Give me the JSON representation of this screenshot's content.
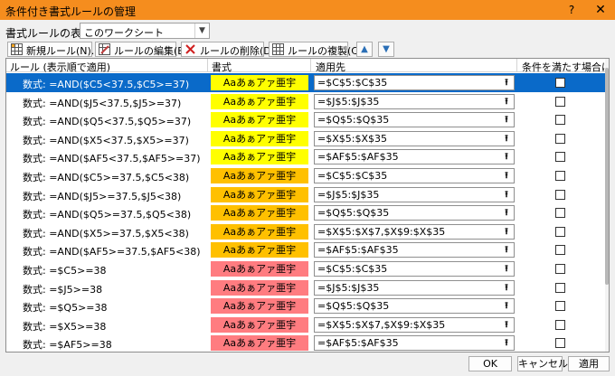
{
  "window": {
    "title": "条件付き書式ルールの管理",
    "help": "?",
    "close": "✕"
  },
  "scope": {
    "label": "書式ルールの表示(S):",
    "value": "このワークシート"
  },
  "toolbar": {
    "new_rule": "新規ルール(N)...",
    "edit_rule": "ルールの編集(E)...",
    "delete_rule": "ルールの削除(D)",
    "duplicate_rule": "ルールの複製(C)"
  },
  "columns": {
    "rule": "ルール (表示順で適用)",
    "format": "書式",
    "applies_to": "適用先",
    "stop_if_true": "条件を満たす場合は停止"
  },
  "colors": {
    "yellow": "#ffff00",
    "orange": "#ffc000",
    "red": "#ff7c80",
    "selection": "#0a6ac9"
  },
  "preview_text": "Aaあぁアァ亜宇",
  "rules": [
    {
      "rule": "数式: =AND($C5<37.5,$C5>=37)",
      "fill": "yellow",
      "range": "=$C$5:$C$35",
      "stop": false,
      "selected": true
    },
    {
      "rule": "数式: =AND($J5<37.5,$J5>=37)",
      "fill": "yellow",
      "range": "=$J$5:$J$35",
      "stop": false,
      "selected": false
    },
    {
      "rule": "数式: =AND($Q5<37.5,$Q5>=37)",
      "fill": "yellow",
      "range": "=$Q$5:$Q$35",
      "stop": false,
      "selected": false
    },
    {
      "rule": "数式: =AND($X5<37.5,$X5>=37)",
      "fill": "yellow",
      "range": "=$X$5:$X$35",
      "stop": false,
      "selected": false
    },
    {
      "rule": "数式: =AND($AF5<37.5,$AF5>=37)",
      "fill": "yellow",
      "range": "=$AF$5:$AF$35",
      "stop": false,
      "selected": false
    },
    {
      "rule": "数式: =AND($C5>=37.5,$C5<38)",
      "fill": "orange",
      "range": "=$C$5:$C$35",
      "stop": false,
      "selected": false
    },
    {
      "rule": "数式: =AND($J5>=37.5,$J5<38)",
      "fill": "orange",
      "range": "=$J$5:$J$35",
      "stop": false,
      "selected": false
    },
    {
      "rule": "数式: =AND($Q5>=37.5,$Q5<38)",
      "fill": "orange",
      "range": "=$Q$5:$Q$35",
      "stop": false,
      "selected": false
    },
    {
      "rule": "数式: =AND($X5>=37.5,$X5<38)",
      "fill": "orange",
      "range": "=$X$5:$X$7,$X$9:$X$35",
      "stop": false,
      "selected": false
    },
    {
      "rule": "数式: =AND($AF5>=37.5,$AF5<38)",
      "fill": "orange",
      "range": "=$AF$5:$AF$35",
      "stop": false,
      "selected": false
    },
    {
      "rule": "数式: =$C5>=38",
      "fill": "red",
      "range": "=$C$5:$C$35",
      "stop": false,
      "selected": false
    },
    {
      "rule": "数式: =$J5>=38",
      "fill": "red",
      "range": "=$J$5:$J$35",
      "stop": false,
      "selected": false
    },
    {
      "rule": "数式: =$Q5>=38",
      "fill": "red",
      "range": "=$Q$5:$Q$35",
      "stop": false,
      "selected": false
    },
    {
      "rule": "数式: =$X5>=38",
      "fill": "red",
      "range": "=$X$5:$X$7,$X$9:$X$35",
      "stop": false,
      "selected": false
    },
    {
      "rule": "数式: =$AF5>=38",
      "fill": "red",
      "range": "=$AF$5:$AF$35",
      "stop": false,
      "selected": false
    }
  ],
  "footer": {
    "ok": "OK",
    "cancel": "キャンセル",
    "apply": "適用"
  }
}
